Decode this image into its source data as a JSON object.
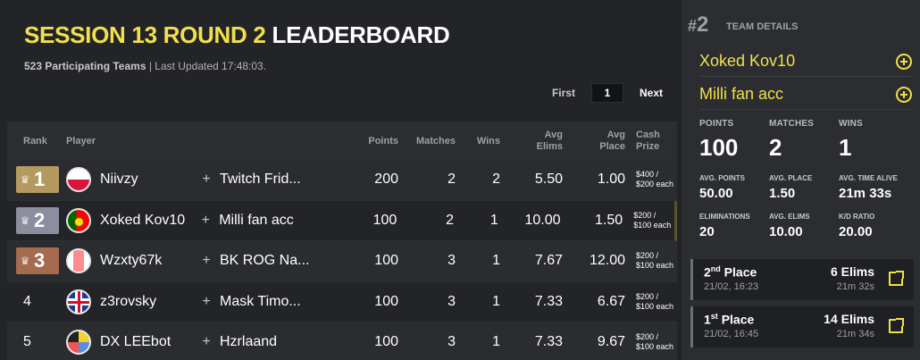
{
  "header": {
    "title_highlight": "SESSION 13 ROUND 2",
    "title_rest": "LEADERBOARD",
    "teams_count": "523 Participating Teams",
    "last_updated": "| Last Updated 17:48:03."
  },
  "pager": {
    "first": "First",
    "page": "1",
    "next": "Next"
  },
  "columns": {
    "rank": "Rank",
    "player": "Player",
    "points": "Points",
    "matches": "Matches",
    "wins": "Wins",
    "avg_elims_1": "Avg",
    "avg_elims_2": "Elims",
    "avg_place_1": "Avg",
    "avg_place_2": "Place",
    "cash_1": "Cash",
    "cash_2": "Prize"
  },
  "rows": [
    {
      "rank": "1",
      "player": "Niivzy",
      "flag": "poland",
      "plus": "+",
      "team": "Twitch Frid...",
      "points": "200",
      "matches": "2",
      "wins": "2",
      "avg_elims": "5.50",
      "avg_place": "1.00",
      "cash1": "$400 /",
      "cash2": "$200 each"
    },
    {
      "rank": "2",
      "player": "Xoked Kov10",
      "flag": "portugal",
      "plus": "+",
      "team": "Milli fan acc",
      "points": "100",
      "matches": "2",
      "wins": "1",
      "avg_elims": "10.00",
      "avg_place": "1.50",
      "cash1": "$200 /",
      "cash2": "$100 each"
    },
    {
      "rank": "3",
      "player": "Wzxty67k",
      "flag": "france",
      "plus": "+",
      "team": "BK ROG Na...",
      "points": "100",
      "matches": "3",
      "wins": "1",
      "avg_elims": "7.67",
      "avg_place": "12.00",
      "cash1": "$200 /",
      "cash2": "$100 each"
    },
    {
      "rank": "4",
      "player": "z3rovsky",
      "flag": "uk",
      "plus": "+",
      "team": "Mask Timo...",
      "points": "100",
      "matches": "3",
      "wins": "1",
      "avg_elims": "7.33",
      "avg_place": "6.67",
      "cash1": "$200 /",
      "cash2": "$100 each"
    },
    {
      "rank": "5",
      "player": "DX LEEbot",
      "flag": "multi",
      "plus": "+",
      "team": "Hzrlaand",
      "points": "100",
      "matches": "3",
      "wins": "1",
      "avg_elims": "7.33",
      "avg_place": "9.67",
      "cash1": "$200 /",
      "cash2": "$100 each"
    }
  ],
  "team_details": {
    "rank_hash": "#",
    "rank_num": "2",
    "label": "TEAM DETAILS",
    "members": [
      "Xoked Kov10",
      "Milli fan acc"
    ],
    "points_label": "POINTS",
    "points": "100",
    "matches_label": "MATCHES",
    "matches": "2",
    "wins_label": "WINS",
    "wins": "1",
    "avg_points_label": "AVG. POINTS",
    "avg_points": "50.00",
    "avg_place_label": "AVG. PLACE",
    "avg_place": "1.50",
    "avg_alive_label": "AVG. TIME ALIVE",
    "avg_alive": "21m 33s",
    "elims_label": "ELIMINATIONS",
    "elims": "20",
    "avg_elims_label": "AVG. ELIMS",
    "avg_elims": "10.00",
    "kd_label": "K/D RATIO",
    "kd": "20.00"
  },
  "matches": [
    {
      "place_num": "2",
      "place_suffix": "nd",
      "place_word": " Place",
      "date": "21/02, 16:23",
      "elims": "6 Elims",
      "alive": "21m 32s"
    },
    {
      "place_num": "1",
      "place_suffix": "st",
      "place_word": " Place",
      "date": "21/02, 16:45",
      "elims": "14 Elims",
      "alive": "21m 34s"
    }
  ],
  "colors": {
    "accent": "#f1e04c",
    "gold": "#b59a5f",
    "silver": "#8b8e9e",
    "bronze": "#a66a4f"
  }
}
